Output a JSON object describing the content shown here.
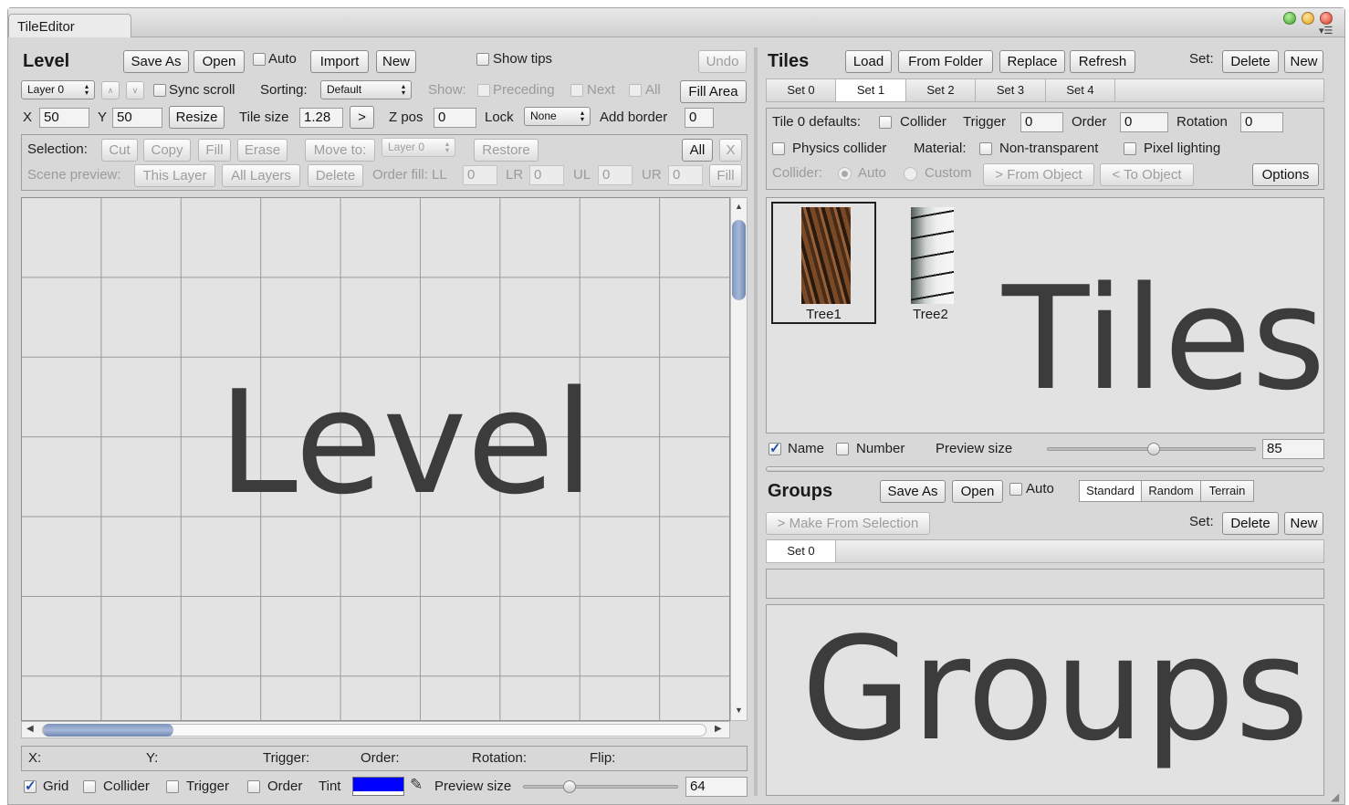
{
  "window": {
    "tab": "TileEditor"
  },
  "level": {
    "title": "Level",
    "save_as": "Save As",
    "open": "Open",
    "auto": "Auto",
    "import": "Import",
    "new": "New",
    "show_tips": "Show tips",
    "undo": "Undo",
    "layer_popup": "Layer 0",
    "up": "∧",
    "down": "∨",
    "sync_scroll": "Sync scroll",
    "sorting_label": "Sorting:",
    "sorting_value": "Default",
    "show_label": "Show:",
    "preceding": "Preceding",
    "next": "Next",
    "all": "All",
    "fill_area": "Fill Area",
    "x_label": "X",
    "x_value": "50",
    "y_label": "Y",
    "y_value": "50",
    "resize": "Resize",
    "tile_size_label": "Tile size",
    "tile_size_value": "1.28",
    "arrow_btn": ">",
    "zpos_label": "Z pos",
    "zpos_value": "0",
    "lock_label": "Lock",
    "lock_value": "None",
    "add_border_label": "Add border",
    "add_border_value": "0",
    "selection_label": "Selection:",
    "cut": "Cut",
    "copy": "Copy",
    "fill": "Fill",
    "erase": "Erase",
    "move_to": "Move to:",
    "move_layer": "Layer 0",
    "restore": "Restore",
    "sel_all": "All",
    "sel_x": "X",
    "scene_preview_label": "Scene preview:",
    "this_layer": "This Layer",
    "all_layers": "All Layers",
    "delete": "Delete",
    "order_fill_label": "Order fill: LL",
    "ll": "0",
    "lr_label": "LR",
    "lr": "0",
    "ul_label": "UL",
    "ul": "0",
    "ur_label": "UR",
    "ur": "0",
    "fill2": "Fill",
    "canvas_text": "Level",
    "info": {
      "x": "X:",
      "y": "Y:",
      "trigger": "Trigger:",
      "order": "Order:",
      "rotation": "Rotation:",
      "flip": "Flip:"
    },
    "bottom": {
      "grid": "Grid",
      "collider": "Collider",
      "trigger": "Trigger",
      "order": "Order",
      "tint": "Tint",
      "tint_color": "#0000ff",
      "preview_size": "Preview size",
      "preview_value": "64",
      "preview_fraction": 0.3
    }
  },
  "tiles": {
    "title": "Tiles",
    "load": "Load",
    "from_folder": "From Folder",
    "replace": "Replace",
    "refresh": "Refresh",
    "set_label": "Set:",
    "delete": "Delete",
    "new": "New",
    "sets": [
      "Set 0",
      "Set 1",
      "Set 2",
      "Set 3",
      "Set 4"
    ],
    "selected_set": 1,
    "defaults_label": "Tile 0 defaults:",
    "collider": "Collider",
    "trigger": "Trigger",
    "trigger_value": "0",
    "order": "Order",
    "order_value": "0",
    "rotation": "Rotation",
    "rotation_value": "0",
    "physics_collider": "Physics collider",
    "material": "Material:",
    "non_transparent": "Non-transparent",
    "pixel_lighting": "Pixel lighting",
    "collider_label": "Collider:",
    "auto": "Auto",
    "custom": "Custom",
    "from_object": "> From Object",
    "to_object": "< To Object",
    "options": "Options",
    "items": [
      {
        "name": "Tree1",
        "icon": "tree-bark-texture"
      },
      {
        "name": "Tree2",
        "icon": "birch-bark-texture"
      }
    ],
    "canvas_text": "Tiles",
    "name_cb": "Name",
    "number_cb": "Number",
    "preview_size": "Preview size",
    "preview_value": "85",
    "preview_fraction": 0.51
  },
  "groups": {
    "title": "Groups",
    "save_as": "Save As",
    "open": "Open",
    "auto": "Auto",
    "modes": [
      "Standard",
      "Random",
      "Terrain"
    ],
    "selected_mode": 0,
    "make_from_selection": "> Make From Selection",
    "set_label": "Set:",
    "delete": "Delete",
    "new": "New",
    "sets": [
      "Set 0"
    ],
    "canvas_text": "Groups"
  }
}
